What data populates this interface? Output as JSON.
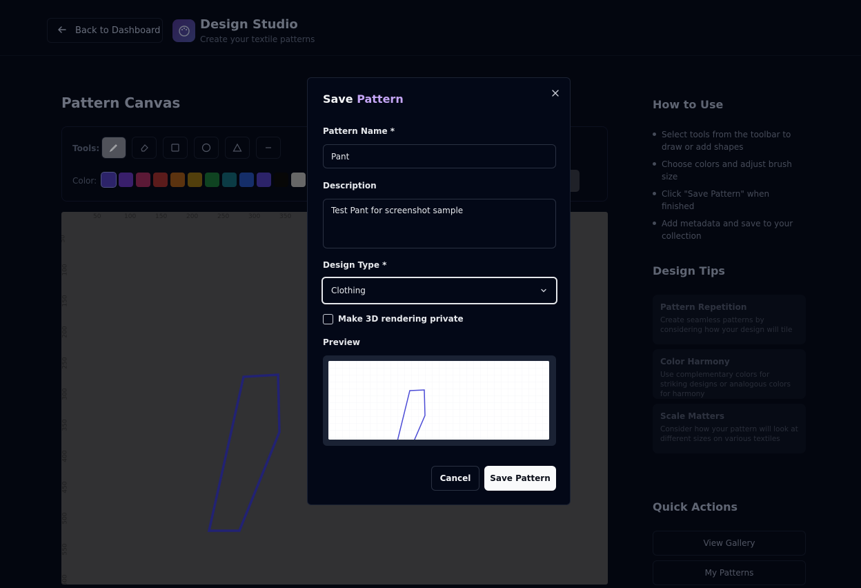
{
  "header": {
    "back_label": "Back to Dashboard",
    "title": "Design Studio",
    "subtitle": "Create your textile patterns"
  },
  "canvas": {
    "title": "Pattern Canvas",
    "tools_label": "Tools:",
    "color_label": "Color:",
    "tools": [
      "pen-icon",
      "eraser-icon",
      "rectangle-icon",
      "circle-icon",
      "triangle-icon",
      "line-icon"
    ],
    "swatches": [
      "#3b2f8c",
      "#4c2a8f",
      "#7a2248",
      "#7a2424",
      "#7a4414",
      "#6e5410",
      "#145a2c",
      "#0f4f5c",
      "#1d3e8c",
      "#3b2f8c",
      "#0a0a0a",
      "#8a8a8a"
    ],
    "ruler_x": [
      "50",
      "100",
      "150",
      "200",
      "250",
      "300",
      "350"
    ],
    "ruler_y": [
      "50",
      "100",
      "150",
      "200",
      "250",
      "300",
      "350",
      "400",
      "450",
      "500",
      "550",
      "600"
    ]
  },
  "sidebar": {
    "how_title": "How to Use",
    "how_items": [
      "Select tools from the toolbar to draw or add shapes",
      "Choose colors and adjust brush size",
      "Click \"Save Pattern\" when finished",
      "Add metadata and save to your collection"
    ],
    "tips_title": "Design Tips",
    "tips": [
      {
        "title": "Pattern Repetition",
        "desc": "Create seamless patterns by considering how your design will tile"
      },
      {
        "title": "Color Harmony",
        "desc": "Use complementary colors for striking designs or analogous colors for harmony"
      },
      {
        "title": "Scale Matters",
        "desc": "Consider how your pattern will look at different sizes on various textiles"
      }
    ],
    "qa_title": "Quick Actions",
    "qa_buttons": [
      "View Gallery",
      "My Patterns"
    ]
  },
  "modal": {
    "title_a": "Save",
    "title_b": "Pattern",
    "name_label": "Pattern Name *",
    "name_value": "Pant",
    "desc_label": "Description",
    "desc_value": "Test Pant for screenshot sample",
    "type_label": "Design Type *",
    "type_value": "Clothing",
    "private_label": "Make 3D rendering private",
    "private_checked": false,
    "preview_label": "Preview",
    "cancel_label": "Cancel",
    "save_label": "Save Pattern"
  },
  "colors": {
    "accent": "#c4a5f5",
    "stroke": "#3f3fc9"
  }
}
